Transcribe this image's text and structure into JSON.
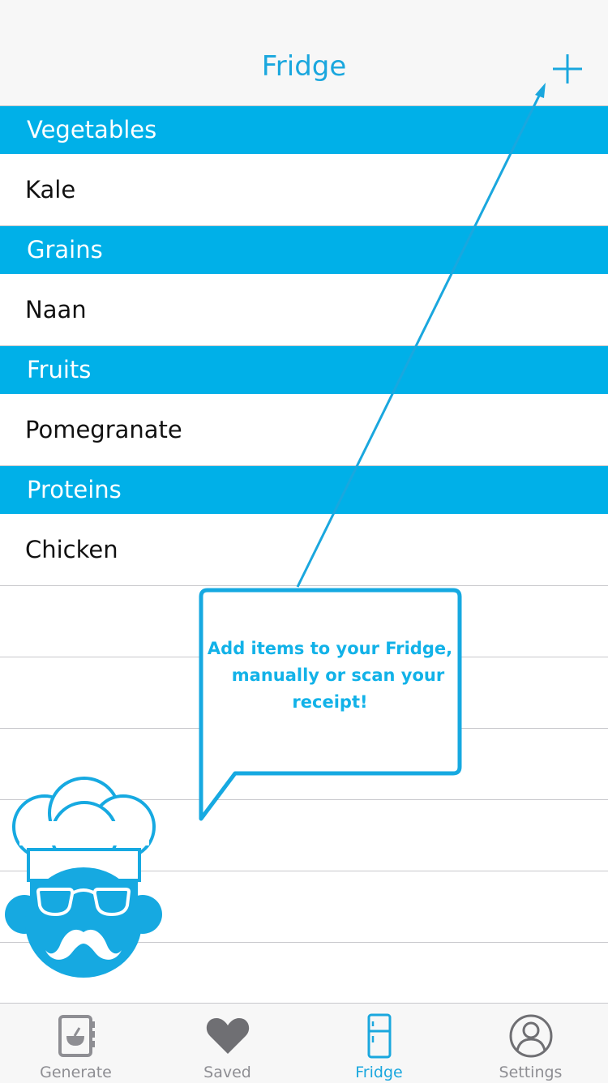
{
  "navbar": {
    "title": "Fridge",
    "add_icon": "plus-icon"
  },
  "sections": [
    {
      "header": "Vegetables",
      "items": [
        "Kale"
      ]
    },
    {
      "header": "Grains",
      "items": [
        "Naan"
      ]
    },
    {
      "header": "Fruits",
      "items": [
        "Pomegranate"
      ]
    },
    {
      "header": "Proteins",
      "items": [
        "Chicken"
      ]
    }
  ],
  "tooltip": {
    "line1": "Add items to your Fridge,",
    "line2": "manually or scan your",
    "line3": "receipt!"
  },
  "tabs": [
    {
      "label": "Generate",
      "icon": "cookbook-icon",
      "active": false
    },
    {
      "label": "Saved",
      "icon": "heart-icon",
      "active": false
    },
    {
      "label": "Fridge",
      "icon": "fridge-icon",
      "active": true
    },
    {
      "label": "Settings",
      "icon": "person-icon",
      "active": false
    }
  ],
  "colors": {
    "accent": "#1aa7de",
    "section": "#00b0e8",
    "tooltip_text": "#12b2e8",
    "inactive": "#8e8e93"
  }
}
